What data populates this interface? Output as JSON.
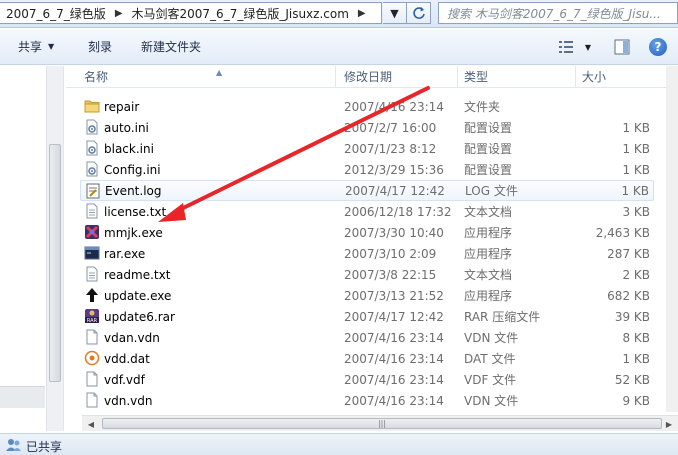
{
  "address_bar": {
    "crumbs": [
      "2007_6_7_绿色版",
      "木马剑客2007_6_7_绿色版_Jisuxz.com"
    ],
    "search_placeholder": "搜索 木马剑客2007_6_7_绿色版_Jisu..."
  },
  "toolbar": {
    "share_label": "共享",
    "burn_label": "刻录",
    "new_folder_label": "新建文件夹"
  },
  "columns": {
    "name": "名称",
    "date": "修改日期",
    "type": "类型",
    "size": "大小"
  },
  "files": [
    {
      "name": "repair",
      "date": "2007/4/16 23:14",
      "type": "文件夹",
      "size": "",
      "icon": "folder-icon"
    },
    {
      "name": "auto.ini",
      "date": "2007/2/7 16:00",
      "type": "配置设置",
      "size": "1 KB",
      "icon": "settings-file-icon"
    },
    {
      "name": "black.ini",
      "date": "2007/1/23 8:12",
      "type": "配置设置",
      "size": "1 KB",
      "icon": "settings-file-icon"
    },
    {
      "name": "Config.ini",
      "date": "2012/3/29 15:36",
      "type": "配置设置",
      "size": "1 KB",
      "icon": "settings-file-icon"
    },
    {
      "name": "Event.log",
      "date": "2007/4/17 12:42",
      "type": "LOG 文件",
      "size": "1 KB",
      "icon": "log-file-icon"
    },
    {
      "name": "license.txt",
      "date": "2006/12/18 17:32",
      "type": "文本文档",
      "size": "3 KB",
      "icon": "text-file-icon"
    },
    {
      "name": "mmjk.exe",
      "date": "2007/3/30 10:40",
      "type": "应用程序",
      "size": "2,463 KB",
      "icon": "mmjk-app-icon"
    },
    {
      "name": "rar.exe",
      "date": "2007/3/10 2:09",
      "type": "应用程序",
      "size": "287 KB",
      "icon": "console-app-icon"
    },
    {
      "name": "readme.txt",
      "date": "2007/3/8 22:15",
      "type": "文本文档",
      "size": "2 KB",
      "icon": "text-file-icon"
    },
    {
      "name": "update.exe",
      "date": "2007/3/13 21:52",
      "type": "应用程序",
      "size": "682 KB",
      "icon": "update-app-icon"
    },
    {
      "name": "update6.rar",
      "date": "2007/4/17 12:42",
      "type": "RAR 压缩文件",
      "size": "39 KB",
      "icon": "rar-archive-icon"
    },
    {
      "name": "vdan.vdn",
      "date": "2007/4/16 23:14",
      "type": "VDN 文件",
      "size": "8 KB",
      "icon": "generic-file-icon"
    },
    {
      "name": "vdd.dat",
      "date": "2007/4/16 23:14",
      "type": "DAT 文件",
      "size": "1 KB",
      "icon": "dat-file-icon"
    },
    {
      "name": "vdf.vdf",
      "date": "2007/4/16 23:14",
      "type": "VDF 文件",
      "size": "52 KB",
      "icon": "generic-file-icon"
    },
    {
      "name": "vdn.vdn",
      "date": "2007/4/16 23:14",
      "type": "VDN 文件",
      "size": "9 KB",
      "icon": "generic-file-icon"
    }
  ],
  "status": {
    "text": "已共享"
  },
  "colors": {
    "annotation_arrow": "#e8262a",
    "accent": "#3c7fb1"
  }
}
